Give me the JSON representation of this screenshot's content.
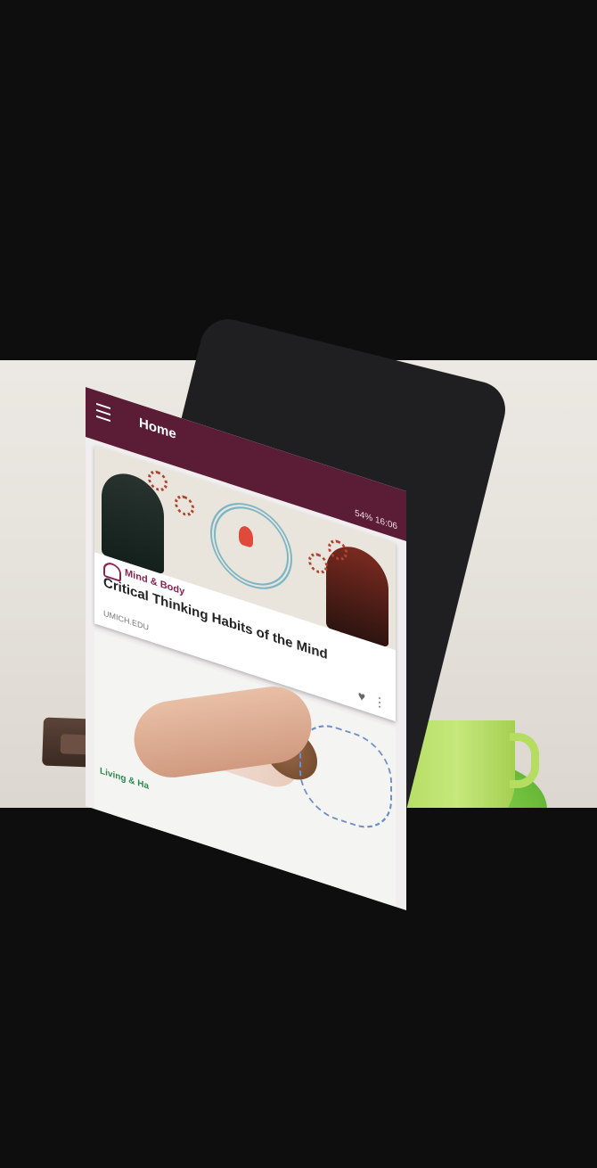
{
  "app": {
    "title": "Home",
    "status_bar": "54% 16:06",
    "brand_color": "#5b1c36"
  },
  "icons": {
    "menu": "menu-icon",
    "favorite": "heart-icon",
    "more": "more-vertical-icon",
    "category": "category-icon"
  },
  "feed": [
    {
      "category": "Mind & Body",
      "title": "Critical Thinking Habits of the Mind",
      "source": "UMICH.EDU"
    },
    {
      "category": "Living & Ha"
    }
  ]
}
